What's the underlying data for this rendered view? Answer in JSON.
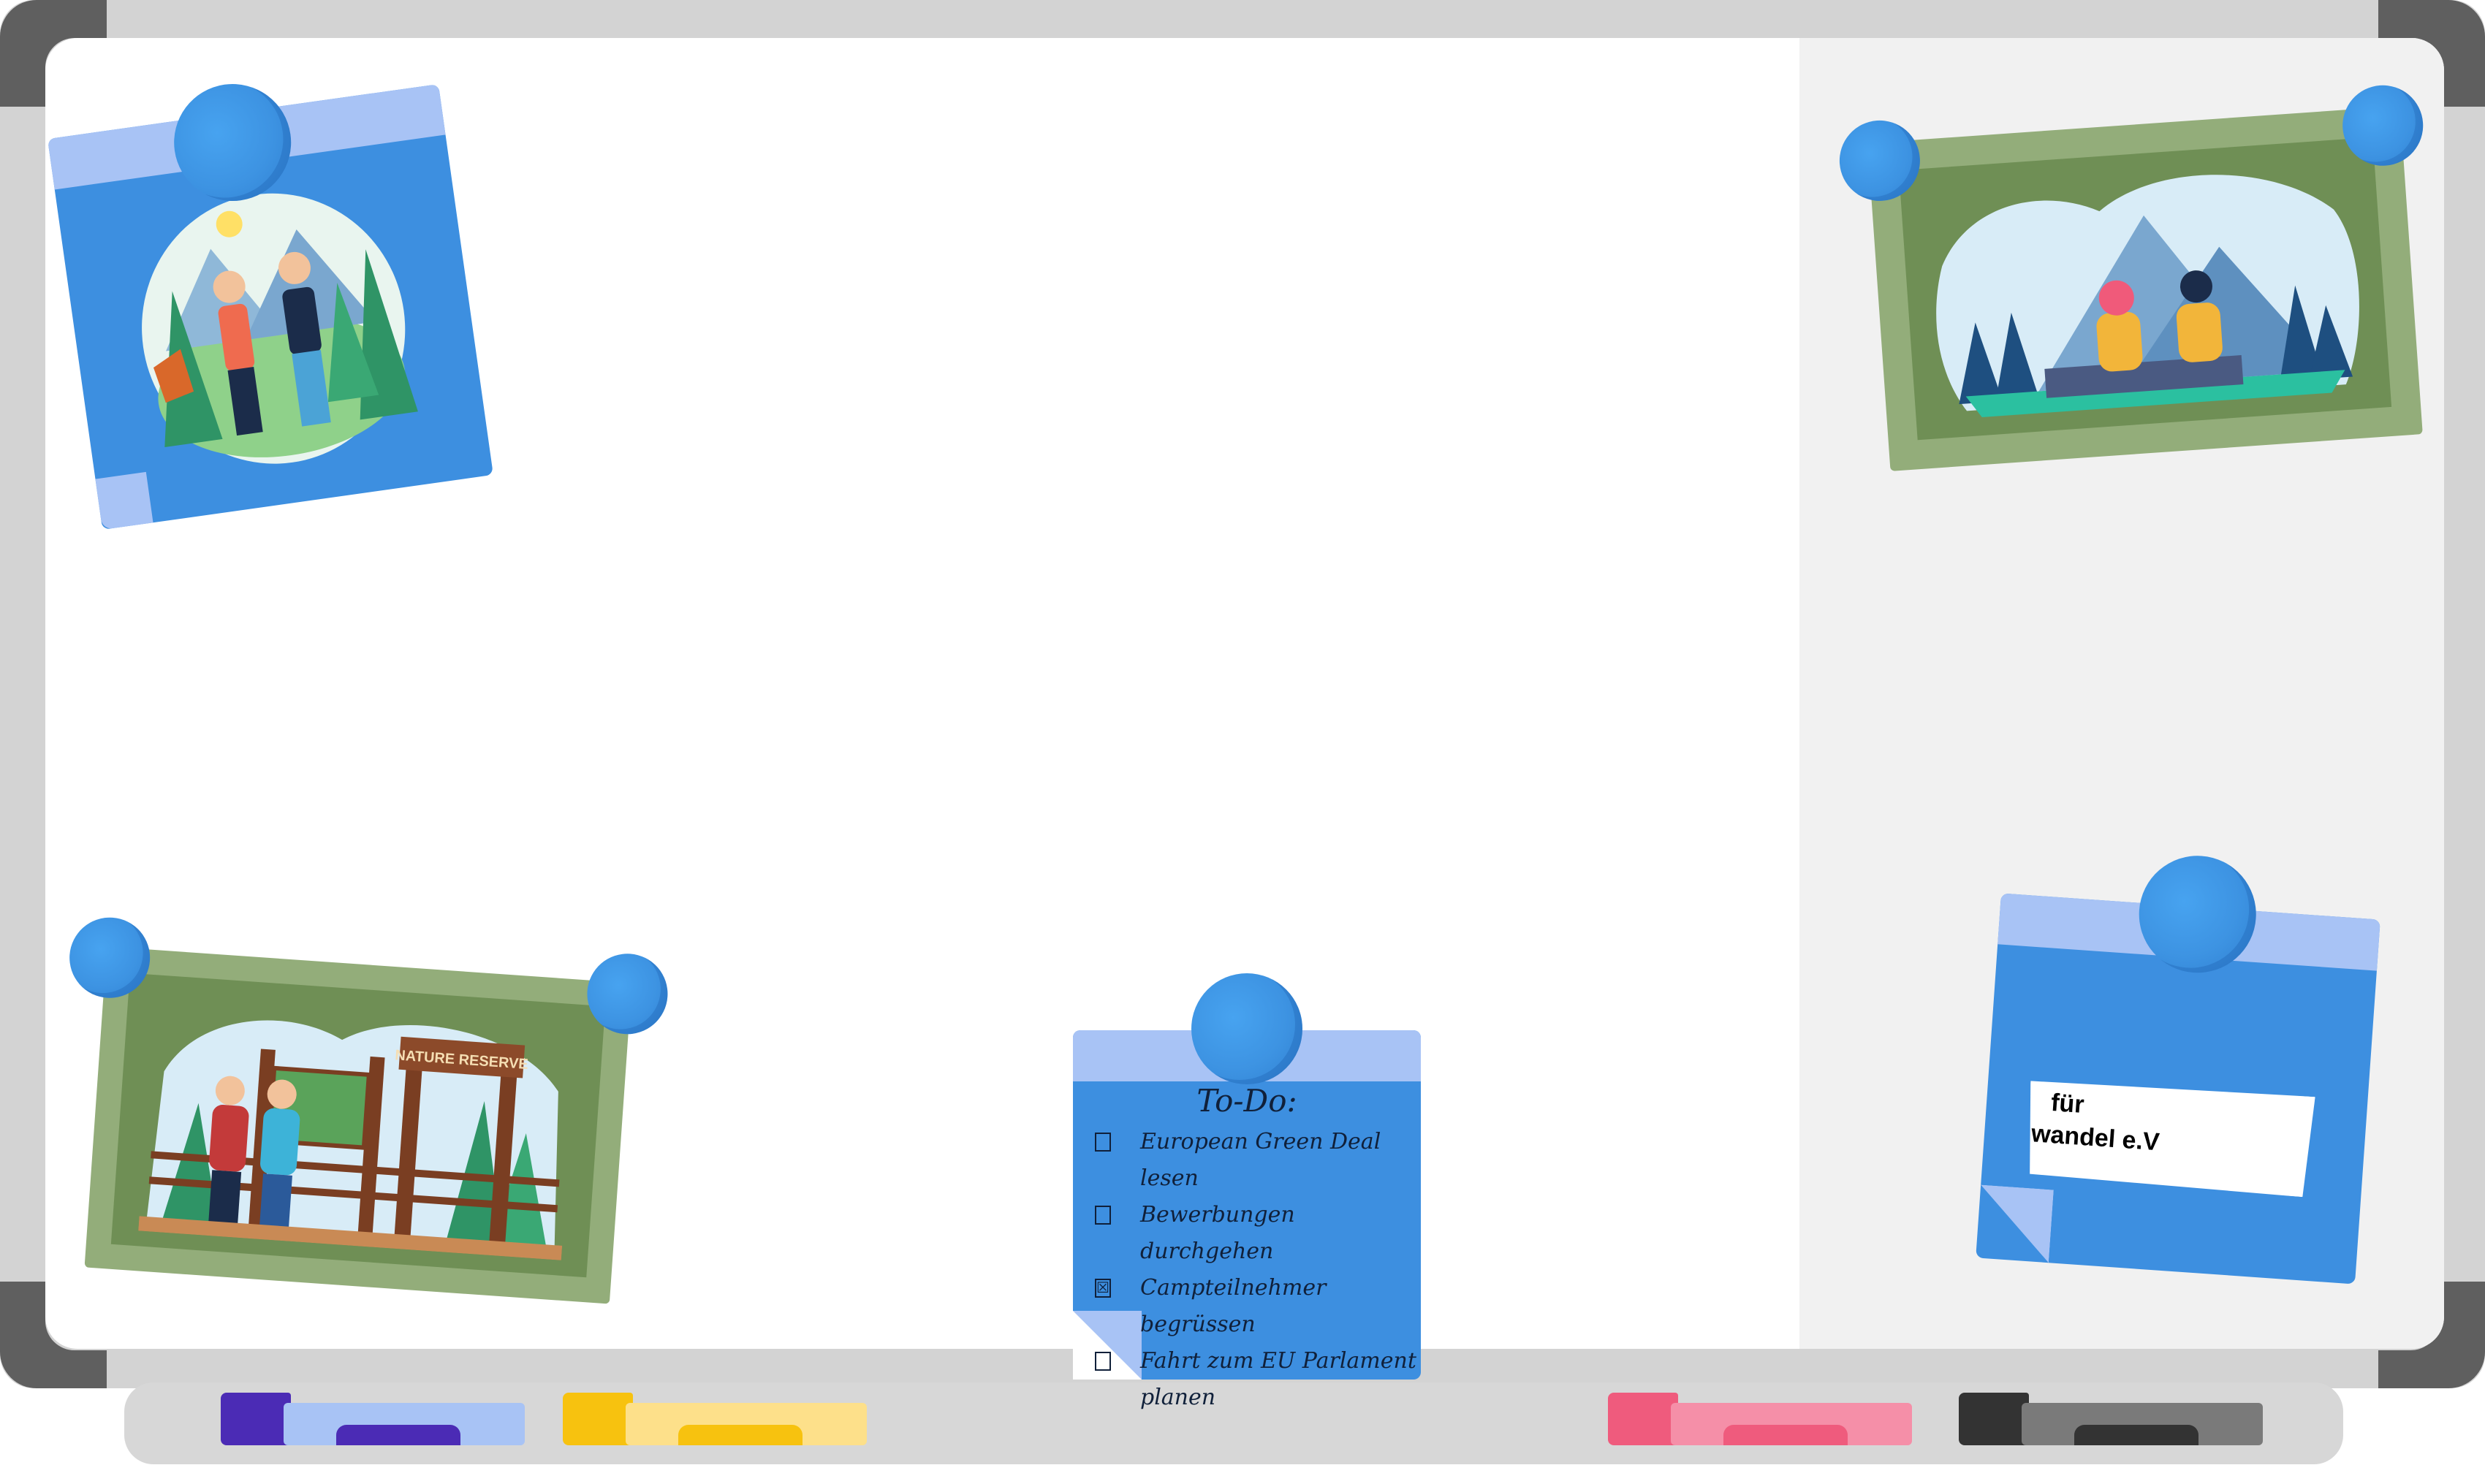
{
  "whiteboard": {
    "frame_color": "#d3d3d3",
    "corner_color": "#5f5f5f",
    "surface_color": "#ffffff"
  },
  "markers": [
    {
      "name": "purple-marker",
      "color": "#4b2bb5",
      "light": "#a8c3f5"
    },
    {
      "name": "yellow-marker",
      "color": "#f7c20f",
      "light": "#fde08a"
    },
    {
      "name": "pink-marker",
      "color": "#ef5b7d",
      "light": "#f58fa8"
    },
    {
      "name": "black-marker",
      "color": "#333333",
      "light": "#7a7a7a"
    }
  ],
  "photos": [
    {
      "name": "hikers-forest-photo",
      "icon": "two-hikers-with-deer-illustration"
    },
    {
      "name": "mountain-lake-photo",
      "icon": "couple-sitting-mountains-illustration"
    },
    {
      "name": "nature-reserve-photo",
      "icon": "hikers-at-nature-reserve-sign-illustration"
    }
  ],
  "nature_reserve_sign": "NATURE RESERVE",
  "todo": {
    "title": "To-Do:",
    "items": [
      {
        "box": "",
        "text": "European Green Deal lesen"
      },
      {
        "box": "",
        "text": "Bewerbungen durchgehen"
      },
      {
        "box": "☒",
        "text": "Campteilnehmer begrüssen"
      },
      {
        "box": "",
        "text": "Fahrt zum EU Parlament planen"
      }
    ]
  },
  "label_note": {
    "line1": "für",
    "line2": "wandel e.V"
  },
  "colors": {
    "note_blue": "#3d8fe0",
    "note_strip": "#a8c3f5",
    "photo_green": "#93ad7a",
    "photo_green_dark": "#6f8f55"
  }
}
